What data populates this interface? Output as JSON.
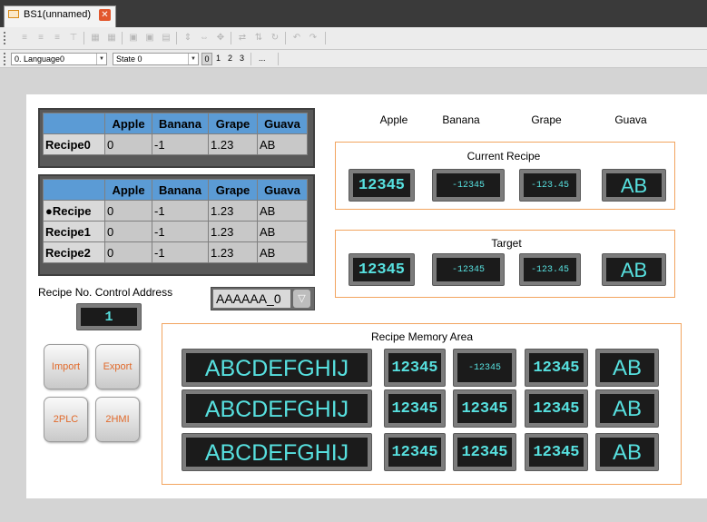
{
  "window": {
    "tab_title": "BS1(unnamed)",
    "close_glyph": "✕"
  },
  "toolbar1": {
    "icons": [
      "align-left-icon",
      "align-center-icon",
      "align-right-icon",
      "align-top-icon",
      "group-icon",
      "ungroup-icon",
      "bring-front-icon",
      "send-back-icon",
      "same-width-icon",
      "same-height-icon",
      "same-size-icon",
      "center-icon",
      "flip-h-icon",
      "flip-v-icon",
      "rotate-icon",
      "undo-icon",
      "redo-icon"
    ]
  },
  "toolbar2": {
    "language": "0. Language0",
    "state": "State 0",
    "items": [
      "0",
      "1",
      "2",
      "3",
      "..."
    ]
  },
  "table1": {
    "columns": [
      "",
      "Apple",
      "Banana",
      "Grape",
      "Guava"
    ],
    "rows": [
      [
        "Recipe0",
        "0",
        "-1",
        "1.23",
        "AB"
      ]
    ]
  },
  "table2": {
    "columns": [
      "",
      "Apple",
      "Banana",
      "Grape",
      "Guava"
    ],
    "rows": [
      [
        "●Recipe",
        "0",
        "-1",
        "1.23",
        "AB"
      ],
      [
        "Recipe1",
        "0",
        "-1",
        "1.23",
        "AB"
      ],
      [
        "Recipe2",
        "0",
        "-1",
        "1.23",
        "AB"
      ]
    ]
  },
  "headers": [
    "Apple",
    "Banana",
    "Grape",
    "Guava"
  ],
  "current_recipe": {
    "title": "Current Recipe",
    "values": [
      "12345",
      "-12345",
      "-123.45",
      "AB"
    ]
  },
  "target": {
    "title": "Target",
    "values": [
      "12345",
      "-12345",
      "-123.45",
      "AB"
    ]
  },
  "control": {
    "label": "Recipe No. Control Address",
    "value": "1",
    "dropdown": "AAAAAA_0"
  },
  "buttons": {
    "import": "Import",
    "export": "Export",
    "to_plc": "2PLC",
    "to_hmi": "2HMI"
  },
  "memory_area": {
    "title": "Recipe Memory Area",
    "rows": [
      [
        "ABCDEFGHIJ",
        "12345",
        "-12345",
        "12345",
        "AB"
      ],
      [
        "ABCDEFGHIJ",
        "12345",
        "12345",
        "12345",
        "AB"
      ],
      [
        "ABCDEFGHIJ",
        "12345",
        "12345",
        "12345",
        "AB"
      ]
    ]
  },
  "colors": {
    "accent_orange": "#f2a45f",
    "lcd_text": "#57e0df",
    "table_header": "#5b9bd5"
  }
}
